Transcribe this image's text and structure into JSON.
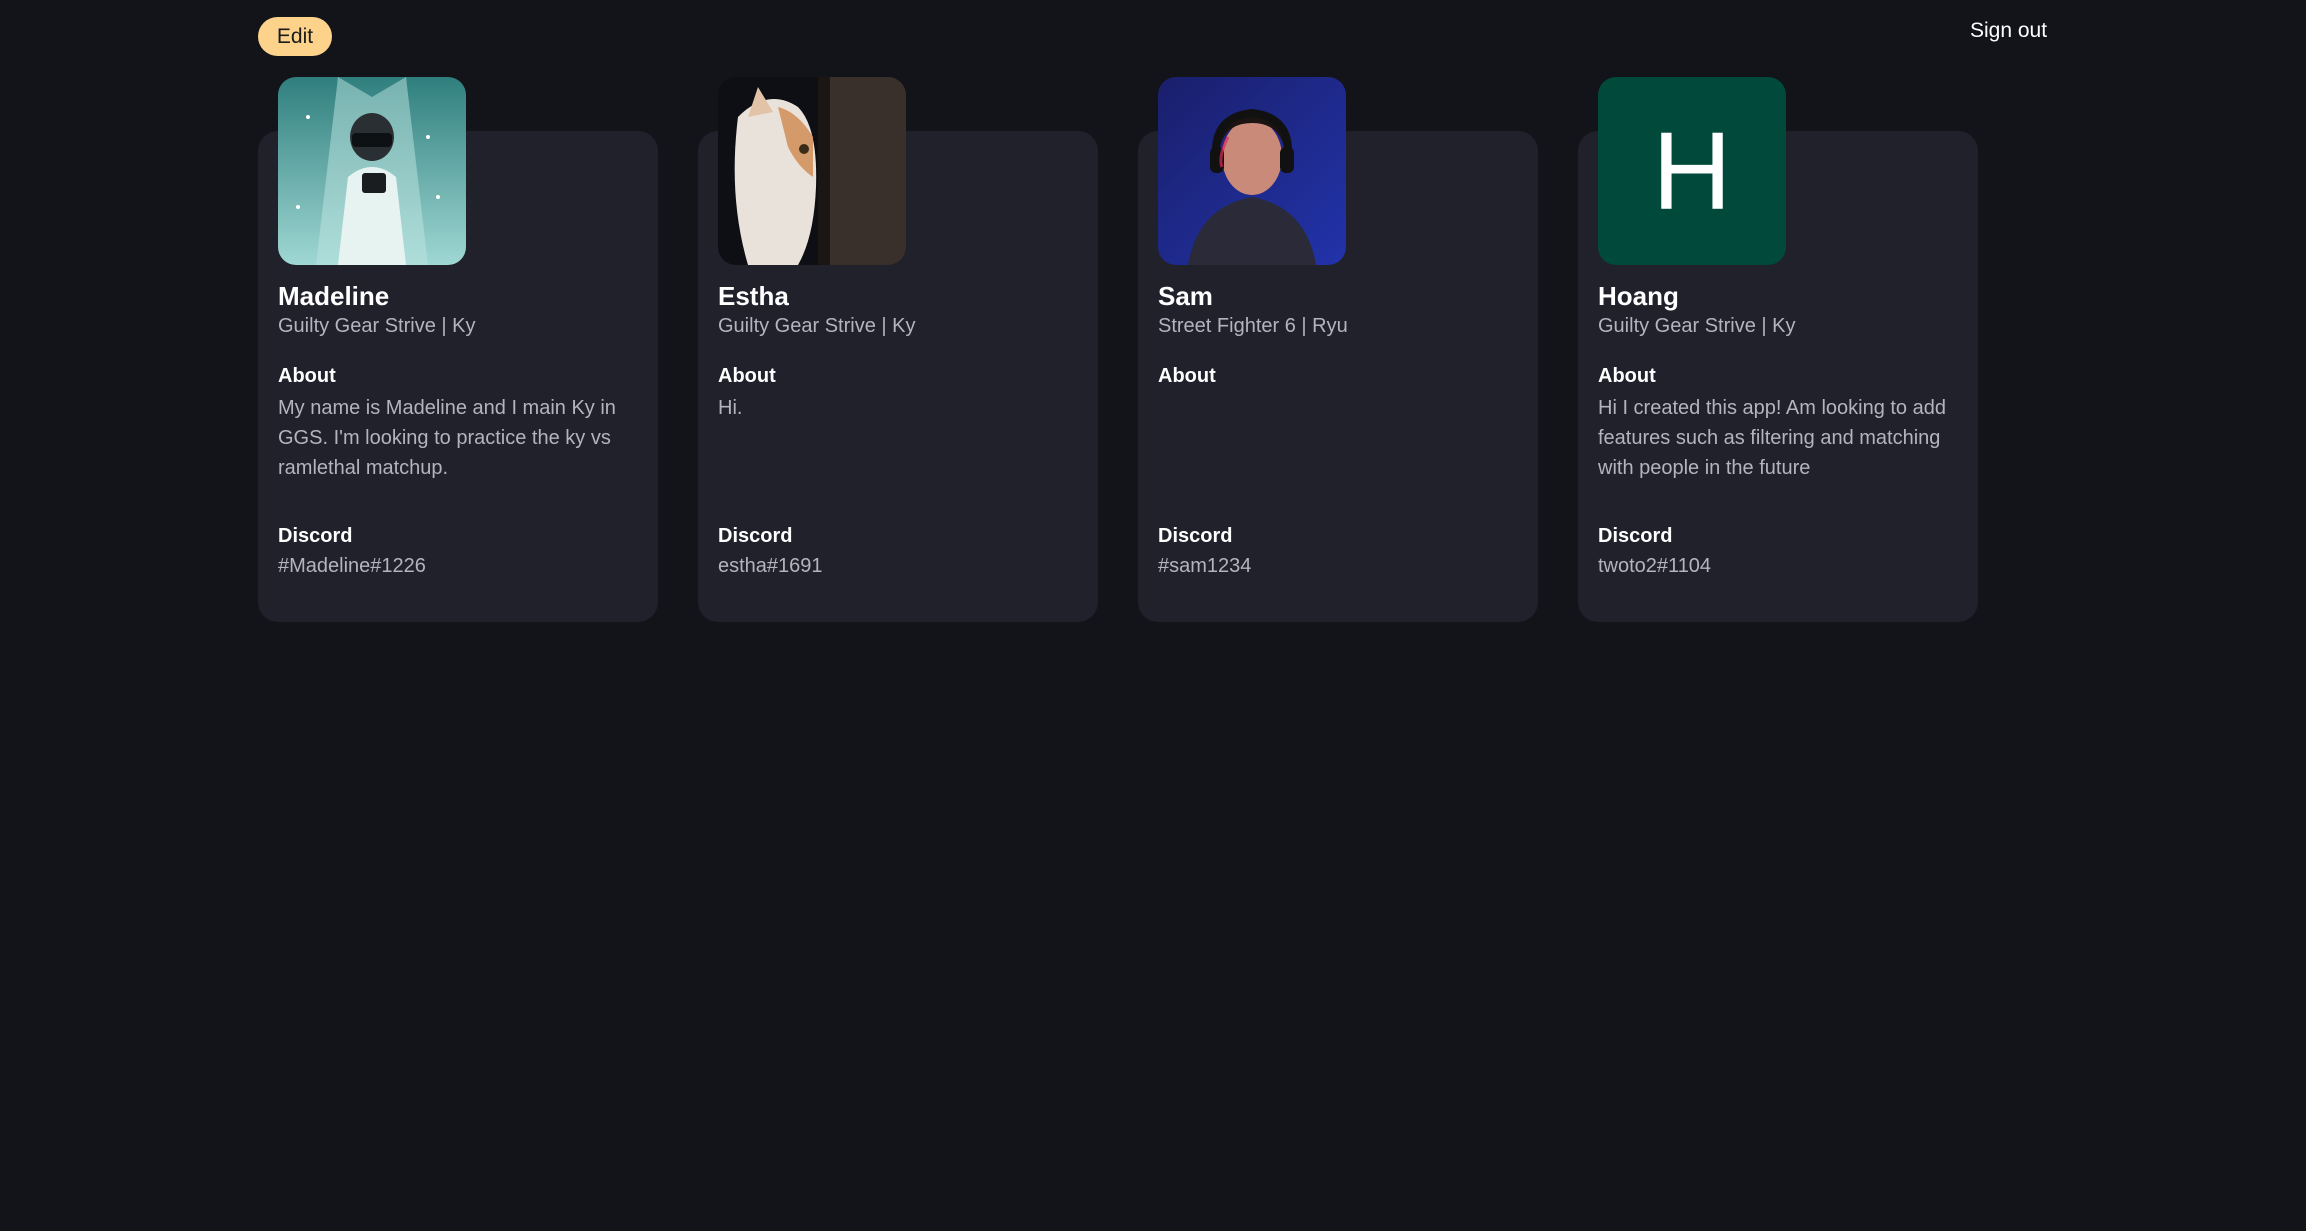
{
  "header": {
    "edit_label": "Edit",
    "signout_label": "Sign out"
  },
  "colors": {
    "background": "#13141a",
    "card": "#20212b",
    "accent": "#fdd28b",
    "avatar_letter_bg": "#01493b"
  },
  "profiles": [
    {
      "name": "Madeline",
      "game": "Guilty Gear Strive | Ky",
      "about_label": "About",
      "about": "My name is Madeline and I main Ky in GGS. I'm looking to practice the ky vs ramlethal matchup.",
      "discord_label": "Discord",
      "discord": "#Madeline#1226"
    },
    {
      "name": "Estha",
      "game": "Guilty Gear Strive | Ky",
      "about_label": "About",
      "about": "Hi.",
      "discord_label": "Discord",
      "discord": "estha#1691"
    },
    {
      "name": "Sam",
      "game": "Street Fighter 6 | Ryu",
      "about_label": "About",
      "about": "",
      "discord_label": "Discord",
      "discord": "#sam1234"
    },
    {
      "name": "Hoang",
      "avatar_letter": "H",
      "game": "Guilty Gear Strive | Ky",
      "about_label": "About",
      "about": "Hi I created this app! Am looking to add features such as filtering and matching with people in the future",
      "discord_label": "Discord",
      "discord": "twoto2#1104"
    }
  ]
}
